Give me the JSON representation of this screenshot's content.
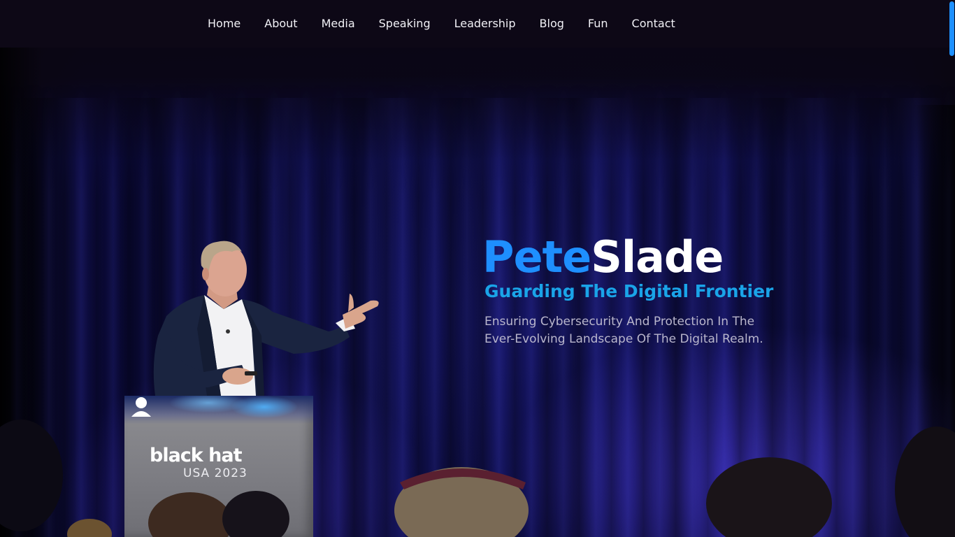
{
  "nav": {
    "items": [
      {
        "label": "Home"
      },
      {
        "label": "About"
      },
      {
        "label": "Media"
      },
      {
        "label": "Speaking"
      },
      {
        "label": "Leadership"
      },
      {
        "label": "Blog"
      },
      {
        "label": "Fun"
      },
      {
        "label": "Contact"
      }
    ]
  },
  "hero": {
    "name_first": "Pete",
    "name_last": "Slade",
    "tagline": "Guarding The Digital Frontier",
    "description": "Ensuring Cybersecurity And Protection In The Ever-Evolving Landscape Of The Digital Realm."
  },
  "hero_photo": {
    "podium_logo": "black hat",
    "podium_logo_sub": "USA 2023"
  },
  "colors": {
    "accent": "#1e8fff",
    "tagline": "#1aa4e8",
    "nav_bg": "#0d0816",
    "nav_text": "#f1f1f6",
    "description": "#b9b6cc"
  }
}
